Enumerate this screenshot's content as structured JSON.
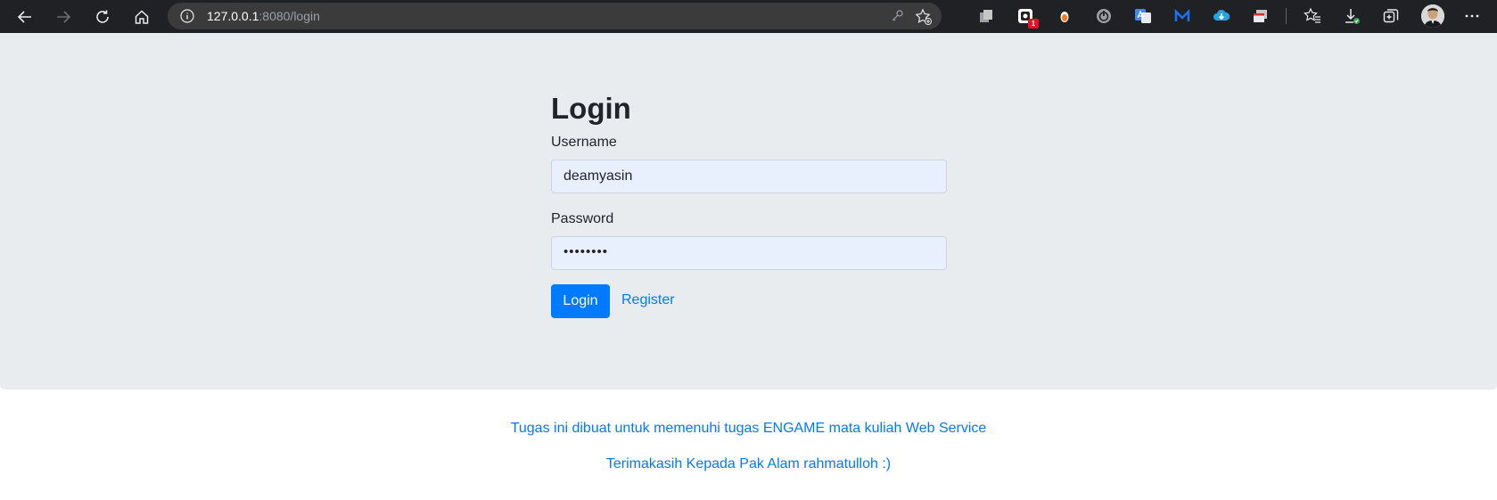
{
  "browser": {
    "url_host": "127.0.0.1",
    "url_path": ":8080/login",
    "extension_badge": "1"
  },
  "page": {
    "title": "Login",
    "username_label": "Username",
    "username_value": "deamyasin",
    "password_label": "Password",
    "password_value": "••••••••",
    "login_button": "Login",
    "register_link": "Register"
  },
  "footer": {
    "line1": "Tugas ini dibuat untuk memenuhi tugas ENGAME mata kuliah Web Service",
    "line2": "Terimakasih Kepada Pak Alam rahmatulloh :)"
  },
  "colors": {
    "toolbar": "#202124",
    "primary": "#007bff",
    "jumbotron": "#e9ecef",
    "autofill": "#e8f0fe"
  }
}
